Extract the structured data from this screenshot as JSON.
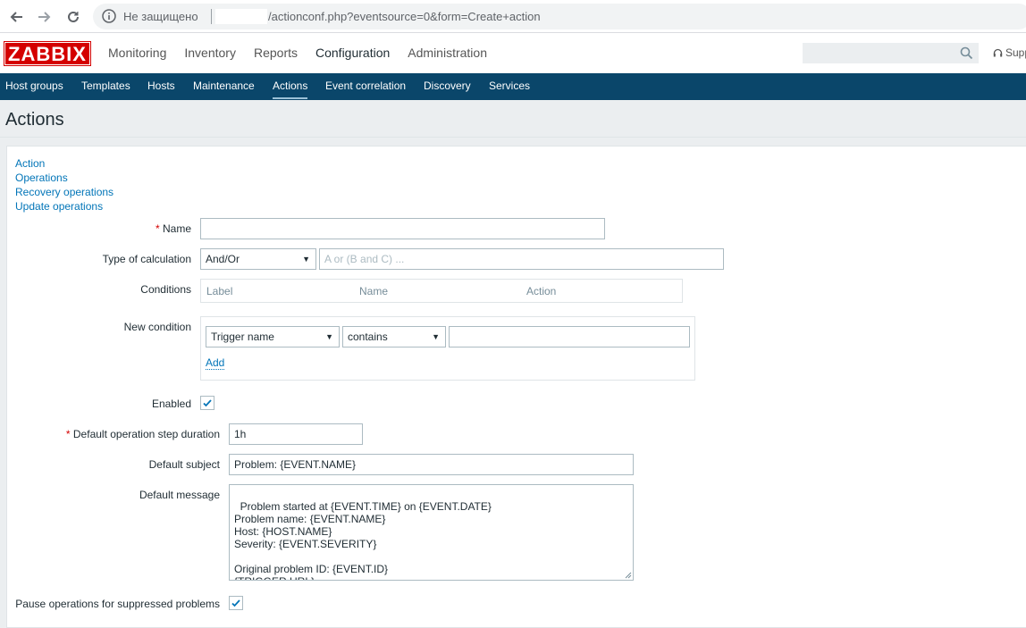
{
  "browser": {
    "security_label": "Не защищено",
    "url_path": "/actionconf.php?eventsource=0&form=Create+action"
  },
  "header": {
    "logo": "ZABBIX",
    "menu": [
      {
        "label": "Monitoring"
      },
      {
        "label": "Inventory"
      },
      {
        "label": "Reports"
      },
      {
        "label": "Configuration"
      },
      {
        "label": "Administration"
      }
    ],
    "search_value": "",
    "support_label": "Supp"
  },
  "submenu": {
    "items": [
      {
        "label": "Host groups"
      },
      {
        "label": "Templates"
      },
      {
        "label": "Hosts"
      },
      {
        "label": "Maintenance"
      },
      {
        "label": "Actions"
      },
      {
        "label": "Event correlation"
      },
      {
        "label": "Discovery"
      },
      {
        "label": "Services"
      }
    ],
    "active": "Actions"
  },
  "page": {
    "title": "Actions"
  },
  "tabs": [
    "Action",
    "Operations",
    "Recovery operations",
    "Update operations"
  ],
  "form": {
    "name_label": "Name",
    "name_value": "",
    "calc_label": "Type of calculation",
    "calc_value": "And/Or",
    "calc_formula_placeholder": "A or (B and C) ...",
    "conditions_label": "Conditions",
    "conditions_columns": [
      "Label",
      "Name",
      "Action"
    ],
    "new_condition_label": "New condition",
    "new_condition_type": "Trigger name",
    "new_condition_operator": "contains",
    "new_condition_value": "",
    "add_label": "Add",
    "enabled_label": "Enabled",
    "enabled_checked": true,
    "step_duration_label": "Default operation step duration",
    "step_duration_value": "1h",
    "subject_label": "Default subject",
    "subject_value": "Problem: {EVENT.NAME}",
    "message_label": "Default message",
    "message_value": "Problem started at {EVENT.TIME} on {EVENT.DATE}\nProblem name: {EVENT.NAME}\nHost: {HOST.NAME}\nSeverity: {EVENT.SEVERITY}\n\nOriginal problem ID: {EVENT.ID}\n{TRIGGER.URL}",
    "pause_label": "Pause operations for suppressed problems",
    "pause_checked": true
  },
  "colors": {
    "brand": "#d40000",
    "submenu_bg": "#0a466a",
    "link": "#0275b8"
  }
}
